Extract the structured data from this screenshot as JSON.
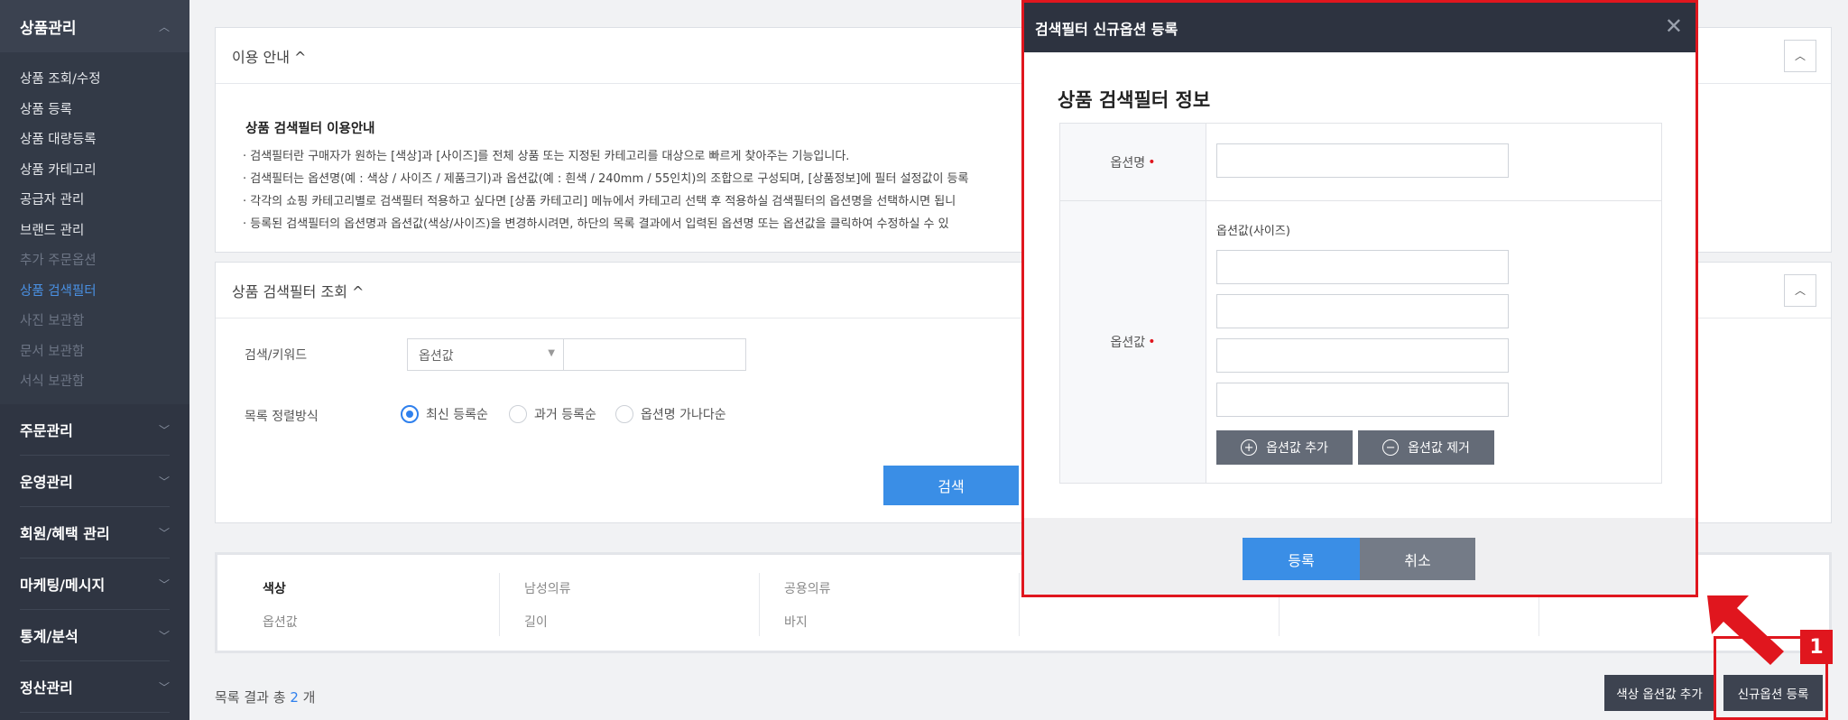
{
  "sidebar": {
    "section_title": "상품관리",
    "items": [
      {
        "label": "상품 조회/수정",
        "state": "normal"
      },
      {
        "label": "상품 등록",
        "state": "normal"
      },
      {
        "label": "상품 대량등록",
        "state": "normal"
      },
      {
        "label": "상품 카테고리",
        "state": "normal"
      },
      {
        "label": "공급자 관리",
        "state": "normal"
      },
      {
        "label": "브랜드 관리",
        "state": "normal"
      },
      {
        "label": "추가 주문옵션",
        "state": "dim"
      },
      {
        "label": "상품 검색필터",
        "state": "active"
      },
      {
        "label": "사진 보관함",
        "state": "dim"
      },
      {
        "label": "문서 보관함",
        "state": "dim"
      },
      {
        "label": "서식 보관함",
        "state": "dim"
      }
    ],
    "groups": [
      "주문관리",
      "운영관리",
      "회원/혜택 관리",
      "마케팅/메시지",
      "통계/분석",
      "정산관리"
    ]
  },
  "guide": {
    "header": "이용 안내 ^",
    "title": "상품 검색필터 이용안내",
    "lines": [
      "· 검색필터란 구매자가 원하는 [색상]과 [사이즈]를 전체 상품 또는 지정된 카테고리를 대상으로 빠르게 찾아주는 기능입니다.",
      "· 검색필터는 옵션명(예 : 색상 / 사이즈 / 제품크기)과 옵션값(예 : 흰색 / 240mm / 55인치)의 조합으로 구성되며, [상품정보]에 필터 설정값이 등록",
      "· 각각의 쇼핑 카테고리별로 검색필터 적용하고 싶다면 [상품 카테고리] 메뉴에서 카테고리 선택 후 적용하실 검색필터의 옵션명을 선택하시면 됩니",
      "· 등록된 검색필터의 옵션명과 옵션값(색상/사이즈)을 변경하시려면, 하단의 목록 결과에서 입력된 옵션명 또는 옵션값을 클릭하여 수정하실 수 있"
    ]
  },
  "search": {
    "header": "상품 검색필터 조회 ^",
    "keyword_label": "검색/키워드",
    "select_value": "옵션값",
    "sort_label": "목록 정렬방식",
    "sort_options": [
      "최신 등록순",
      "과거 등록순",
      "옵션명 가나다순"
    ],
    "button": "검색"
  },
  "table": {
    "columns": [
      {
        "head": "색상",
        "sub": "옵션값"
      },
      {
        "head": "남성의류",
        "sub": "길이"
      },
      {
        "head": "공용의류",
        "sub": "바지"
      }
    ]
  },
  "footer": {
    "result_prefix": "목록 결과 총",
    "result_count": "2",
    "result_suffix": "개",
    "add_color_button": "색상 옵션값 추가",
    "new_option_button": "신규옵션 등록",
    "step_badge": "1"
  },
  "modal": {
    "window_title": "검색필터 신규옵션 등록",
    "section_title": "상품 검색필터 정보",
    "option_name_label": "옵션명",
    "option_value_label": "옵션값",
    "option_value_sub": "옵션값(사이즈)",
    "add_value_button": "옵션값 추가",
    "remove_value_button": "옵션값 제거",
    "confirm_button": "등록",
    "cancel_button": "취소"
  },
  "colors": {
    "accent": "#3a8ee6",
    "highlight": "#e0161e",
    "sidebar": "#2f3542"
  }
}
